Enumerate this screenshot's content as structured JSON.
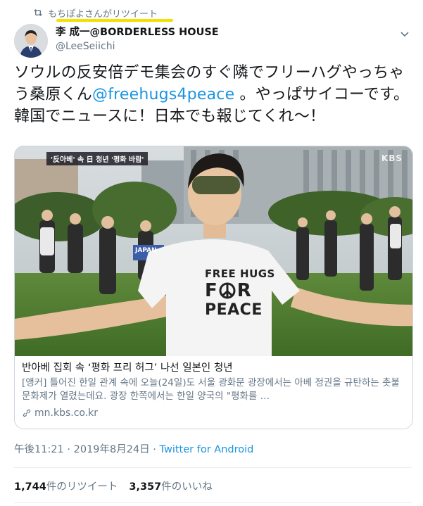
{
  "retweet": {
    "icon": "retweet-icon",
    "text": "もちぽよさんがリツイート"
  },
  "author": {
    "display_name": "李 成一@BORDERLESS HOUSE",
    "handle": "@LeeSeiichi",
    "avatar": "avatar"
  },
  "tweet": {
    "text_before": "ソウルの反安倍デモ集会のすぐ隣でフリーハグやっちゃう桑原くん",
    "mention": "@freehugs4peace",
    "text_after": " 。やっぱサイコーです。韓国でニュースに！日本でも報じてくれ〜！"
  },
  "card": {
    "image_caption_tag": "'反아베' 속 日 청년 '평화 바람'",
    "broadcaster": "KBS",
    "sign_text": "JAPAN",
    "shirt_text_1": "FREE HUGS",
    "shirt_text_2": "F",
    "shirt_text_3": "R",
    "shirt_text_4": "PEACE",
    "title": "반아베 집회 속 ‘평화 프리 허그’ 나선 일본인 청년",
    "description": "[앵커] 틀어진 한일 관계 속에 오늘(24일)도 서울 광화문 광장에서는 아베 정권을 규탄하는 촛불 문화제가 열렸는데요. 광장 한쪽에서는 한일 양국의 \"평화를 …",
    "url": "mn.kbs.co.kr"
  },
  "meta": {
    "time": "午後11:21 · 2019年8月24日 · ",
    "client": "Twitter for Android"
  },
  "stats": {
    "retweets_count": "1,744",
    "retweets_label": "件のリツイート",
    "likes_count": "3,357",
    "likes_label": "件のいいね"
  },
  "colors": {
    "link": "#1b95e0",
    "secondary": "#657786",
    "highlight": "#f5e100"
  }
}
